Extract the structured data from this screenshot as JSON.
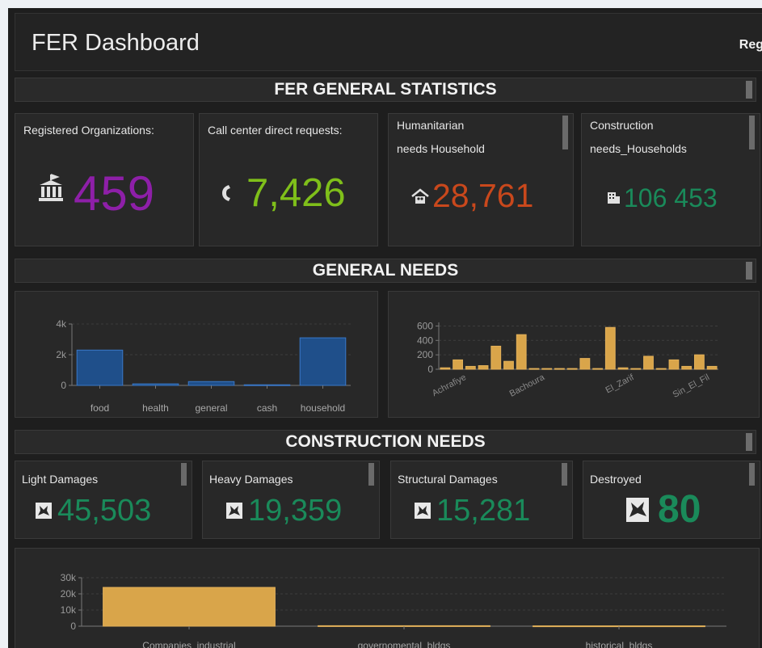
{
  "header": {
    "title": "FER Dashboard",
    "right_text": "Reg"
  },
  "sections": {
    "general_statistics": "FER GENERAL STATISTICS",
    "general_needs": "GENERAL NEEDS",
    "construction_needs": "CONSTRUCTION NEEDS"
  },
  "stats": [
    {
      "label": "Registered Organizations:",
      "value": "459",
      "color": "#8e1fa8",
      "icon": "government-building-icon"
    },
    {
      "label": "Call center direct requests:",
      "value": "7,426",
      "color": "#7fbf1a",
      "icon": "phone-icon"
    },
    {
      "label_line1": "Humanitarian",
      "label_line2": "needs  Household",
      "value": "28,761",
      "color": "#c9481c",
      "icon": "house-icon"
    },
    {
      "label_line1": "Construction",
      "label_line2": "needs_Households",
      "value": "106 453",
      "color": "#1a8a5a",
      "icon": "building-icon"
    }
  ],
  "construction": [
    {
      "label": "Light Damages",
      "value": "45,503",
      "color": "#1a8a5a",
      "icon": "damage-icon"
    },
    {
      "label": "Heavy Damages",
      "value": "19,359",
      "color": "#1a8a5a",
      "icon": "damage-icon"
    },
    {
      "label": "Structural Damages",
      "value": "15,281",
      "color": "#1a8a5a",
      "icon": "damage-icon"
    },
    {
      "label": "Destroyed",
      "value": "80",
      "color": "#1a8a5a",
      "icon": "destroyed-icon"
    }
  ],
  "chart_data": [
    {
      "type": "bar",
      "categories": [
        "food",
        "health",
        "general",
        "cash",
        "household"
      ],
      "values": [
        2300,
        100,
        250,
        40,
        3100
      ],
      "yticks": [
        "4k",
        "2k",
        "0"
      ],
      "ylim": [
        0,
        4000
      ],
      "color": "#1f4f8a",
      "grid": true
    },
    {
      "type": "bar",
      "x_tick_labels": [
        "Achrafiye",
        "Bachoura",
        "El_Zarif",
        "Sin_El_Fil"
      ],
      "values": [
        20,
        130,
        40,
        50,
        320,
        110,
        480,
        10,
        10,
        10,
        10,
        150,
        10,
        580,
        20,
        10,
        180,
        10,
        130,
        40,
        200,
        40
      ],
      "yticks": [
        "600",
        "400",
        "200",
        "0"
      ],
      "ylim": [
        0,
        650
      ],
      "color": "#d9a54a",
      "grid": true
    },
    {
      "type": "bar",
      "categories": [
        "Companies_industrial",
        "governomental_bldgs",
        "historical_bldgs"
      ],
      "values": [
        24000,
        300,
        200
      ],
      "yticks": [
        "30k",
        "20k",
        "10k",
        "0"
      ],
      "ylim": [
        0,
        30000
      ],
      "color": "#d9a54a",
      "grid": true
    }
  ]
}
